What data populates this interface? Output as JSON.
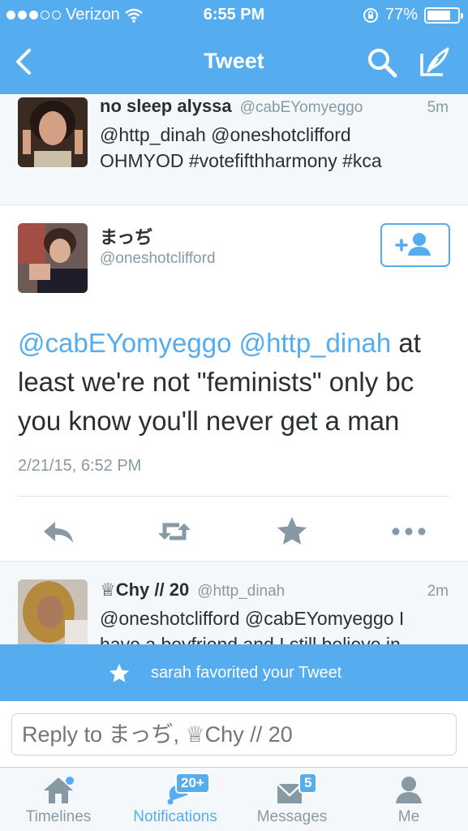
{
  "status_bar": {
    "carrier": "Verizon",
    "time": "6:55 PM",
    "battery_percent": "77%",
    "battery_level": 0.77,
    "signal_bars_filled": 3,
    "signal_bars_total": 5
  },
  "nav": {
    "title": "Tweet",
    "back_icon": "chevron-left-icon",
    "search_icon": "search-icon",
    "compose_icon": "compose-icon"
  },
  "tweet_above": {
    "name": "no sleep alyssa",
    "handle": "@cabEYomyeggo",
    "time": "5m",
    "line1": "@http_dinah @oneshotclifford",
    "line2": "OHMYOD #votefifthharmony #kca"
  },
  "main_tweet": {
    "name": "まっぢ",
    "handle": "@oneshotclifford",
    "mention1": "@cabEYomyeggo",
    "mention2": "@http_dinah",
    "text_after_mentions": " at least we're not \"feminists\" only bc you know you'll never get a man",
    "date": "2/21/15, 6:52 PM",
    "follow_icon": "add-user-icon"
  },
  "actions": {
    "reply_icon": "reply-icon",
    "retweet_icon": "retweet-icon",
    "favorite_icon": "star-icon",
    "more_icon": "more-icon"
  },
  "tweet_below": {
    "name": "♕Chy // 20",
    "handle": "@http_dinah",
    "time": "2m",
    "line1": "@oneshotclifford @cabEYomyeggo I",
    "line2": "have a boyfriend and I still believe in"
  },
  "toast": {
    "message": "sarah favorited your Tweet"
  },
  "reply": {
    "placeholder": "Reply to まっぢ, ♕Chy // 20"
  },
  "tabs": [
    {
      "label": "Timelines",
      "icon": "home-icon"
    },
    {
      "label": "Notifications",
      "icon": "bell-icon",
      "badge": "20+"
    },
    {
      "label": "Messages",
      "icon": "envelope-icon",
      "badge": "5"
    },
    {
      "label": "Me",
      "icon": "person-icon"
    }
  ],
  "colors": {
    "brand": "#55acee",
    "text": "#292f33",
    "muted": "#8899a6"
  }
}
